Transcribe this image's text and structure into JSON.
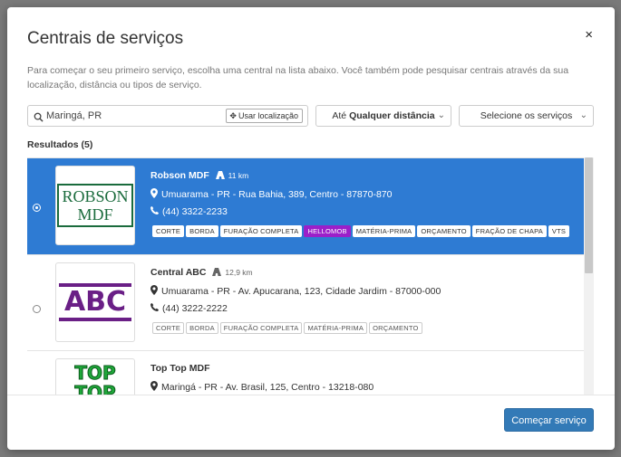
{
  "modal": {
    "title": "Centrais de serviços",
    "close": "×",
    "description": "Para começar o seu primeiro serviço, escolha uma central na lista abaixo. Você também pode pesquisar centrais através da sua localização, distância ou tipos de serviço."
  },
  "search": {
    "value": "Maringá, PR",
    "location_button": "Usar localização"
  },
  "distance_select": {
    "prefix": "Até",
    "value": "Qualquer distância"
  },
  "services_select": {
    "value": "Selecione os serviços"
  },
  "results_label": "Resultados (5)",
  "items": [
    {
      "name": "Robson MDF",
      "distance": "11 km",
      "address": "Umuarama - PR - Rua Bahia, 389, Centro - 87870-870",
      "phone": "(44) 3322-2233",
      "logo_line1": "ROBSON",
      "logo_line2": "MDF",
      "tags": [
        "CORTE",
        "BORDA",
        "FURAÇÃO COMPLETA",
        "HELLOMOB",
        "MATÉRIA-PRIMA",
        "ORÇAMENTO",
        "FRAÇÃO DE CHAPA",
        "VTS"
      ],
      "selected": true
    },
    {
      "name": "Central ABC",
      "distance": "12,9 km",
      "address": "Umuarama - PR - Av. Apucarana, 123, Cidade Jardim - 87000-000",
      "phone": "(44) 3222-2222",
      "logo_text": "ABC",
      "tags": [
        "CORTE",
        "BORDA",
        "FURAÇÃO COMPLETA",
        "MATÉRIA-PRIMA",
        "ORÇAMENTO"
      ],
      "selected": false
    },
    {
      "name": "Top Top MDF",
      "address": "Maringá - PR - Av. Brasil, 125, Centro - 13218-080",
      "logo_line1": "TOP",
      "logo_line2": "TOP",
      "selected": false
    }
  ],
  "footer": {
    "start_button": "Começar serviço"
  },
  "colors": {
    "selected_bg": "#2e7bd3",
    "button_bg": "#337ab7",
    "hellomob_tag": "#9b1fc9",
    "robson_logo": "#1a6b3c",
    "abc_logo": "#6a1f86",
    "top_logo": "#1fa83a"
  }
}
